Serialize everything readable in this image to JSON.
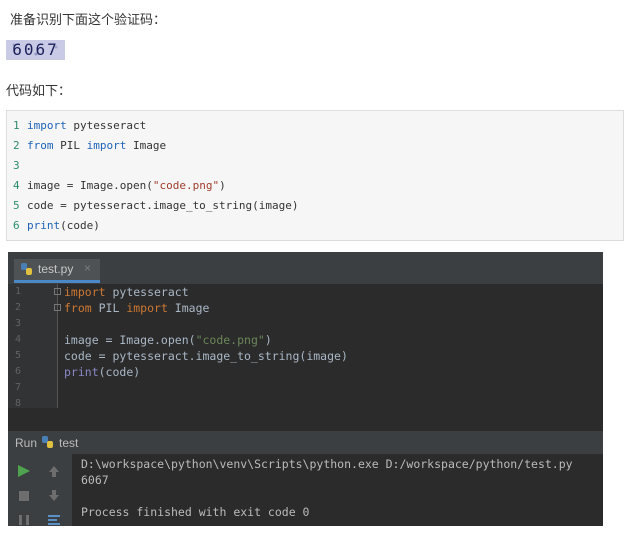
{
  "article": {
    "intro": "准备识别下面这个验证码：",
    "captcha_text": "6067",
    "code_intro": "代码如下：",
    "code_lines": [
      {
        "n": "1",
        "kw1": "import",
        "t1": " pytesseract",
        "kw2": "",
        "t2": "",
        "str": "",
        "t3": ""
      },
      {
        "n": "2",
        "kw1": "from",
        "t1": " PIL ",
        "kw2": "import",
        "t2": " Image",
        "str": "",
        "t3": ""
      },
      {
        "n": "3",
        "kw1": "",
        "t1": "",
        "kw2": "",
        "t2": "",
        "str": "",
        "t3": ""
      },
      {
        "n": "4",
        "kw1": "",
        "t1": "image = Image.open(",
        "kw2": "",
        "t2": "",
        "str": "\"code.png\"",
        "t3": ")"
      },
      {
        "n": "5",
        "kw1": "",
        "t1": "code = pytesseract.image_to_string(image)",
        "kw2": "",
        "t2": "",
        "str": "",
        "t3": ""
      },
      {
        "n": "6",
        "kw1": "print",
        "t1": "(code)",
        "kw2": "",
        "t2": "",
        "str": "",
        "t3": ""
      }
    ]
  },
  "ide": {
    "tab_label": "test.py",
    "tab_close": "×",
    "gutter_numbers": [
      "1",
      "2",
      "3",
      "4",
      "5",
      "6",
      "7",
      "8"
    ],
    "editor_lines": [
      {
        "kw1": "import",
        "t1": " pytesseract",
        "kw2": "",
        "t2": "",
        "str": "",
        "t3": ""
      },
      {
        "kw1": "from",
        "t1": " PIL ",
        "kw2": "import",
        "t2": " Image",
        "str": "",
        "t3": ""
      },
      {
        "kw1": "",
        "t1": "",
        "kw2": "",
        "t2": "",
        "str": "",
        "t3": ""
      },
      {
        "kw1": "",
        "t1": "image = Image.open(",
        "kw2": "",
        "t2": "",
        "str": "\"code.png\"",
        "t3": ")"
      },
      {
        "kw1": "",
        "t1": "code = pytesseract.image_to_string(image)",
        "kw2": "",
        "t2": "",
        "str": "",
        "t3": ""
      },
      {
        "kw1": "",
        "t1": "",
        "kw2": "",
        "t2": "",
        "str": "",
        "t3": "",
        "bi": "print",
        "t4": "(code)"
      }
    ],
    "run_label": "Run",
    "run_name": "test",
    "console_lines": [
      "D:\\workspace\\python\\venv\\Scripts\\python.exe D:/workspace/python/test.py",
      "6067",
      "",
      "Process finished with exit code 0"
    ]
  },
  "colors": {
    "ide_bg": "#2b2b2b",
    "panel_bg": "#3c3f41",
    "keyword": "#cc7832",
    "string": "#6a8759",
    "builtin": "#8888c6"
  }
}
